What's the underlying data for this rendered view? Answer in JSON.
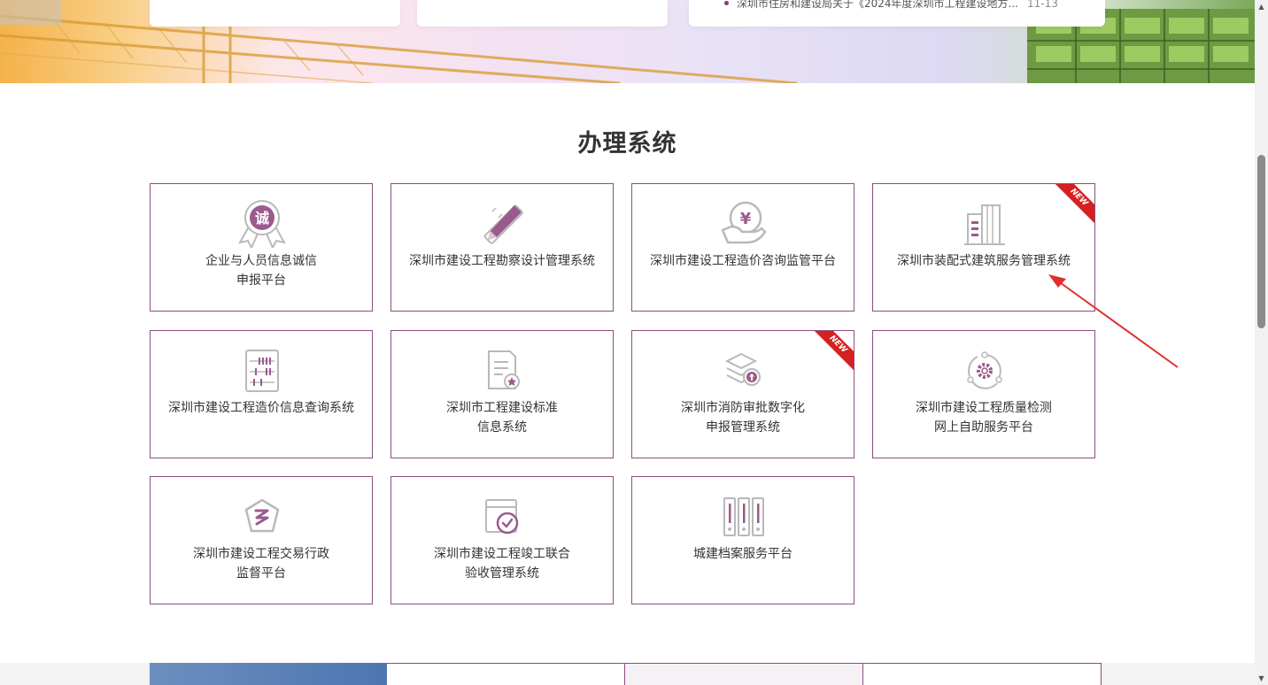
{
  "news": {
    "item_text": "深圳市住房和建设局关于《2024年度深圳市工程建设地方...",
    "item_date": "11-13"
  },
  "section": {
    "title": "办理系统"
  },
  "systems": [
    {
      "line1": "企业与人员信息诚信",
      "line2": "申报平台",
      "icon": "integrity-medal-icon",
      "icon_text": "诚",
      "is_new": false
    },
    {
      "line1": "深圳市建设工程勘察设计管理系统",
      "line2": "",
      "icon": "pencil-ruler-icon",
      "is_new": false
    },
    {
      "line1": "深圳市建设工程造价咨询监管平台",
      "line2": "",
      "icon": "yuan-hand-icon",
      "icon_text": "¥",
      "is_new": false
    },
    {
      "line1": "深圳市装配式建筑服务管理系统",
      "line2": "",
      "icon": "buildings-icon",
      "is_new": true
    },
    {
      "line1": "深圳市建设工程造价信息查询系统",
      "line2": "",
      "icon": "abacus-icon",
      "is_new": false
    },
    {
      "line1": "深圳市工程建设标准",
      "line2": "信息系统",
      "icon": "document-star-icon",
      "is_new": false
    },
    {
      "line1": "深圳市消防审批数字化",
      "line2": "申报管理系统",
      "icon": "layers-upload-icon",
      "is_new": true
    },
    {
      "line1": "深圳市建设工程质量检测",
      "line2": "网上自助服务平台",
      "icon": "gear-cycle-icon",
      "is_new": false
    },
    {
      "line1": "深圳市建设工程交易行政",
      "line2": "监督平台",
      "icon": "pentagon-shield-icon",
      "is_new": false
    },
    {
      "line1": "深圳市建设工程竣工联合",
      "line2": "验收管理系统",
      "icon": "calendar-check-icon",
      "is_new": false
    },
    {
      "line1": "城建档案服务平台",
      "line2": "",
      "icon": "archive-binders-icon",
      "is_new": false
    }
  ],
  "badge": {
    "new_label": "NEW"
  },
  "scrollbar": {
    "up": "▲",
    "down": "▼"
  },
  "colors": {
    "accent": "#8b4e80",
    "ribbon": "#d62020",
    "arrow": "#e0302a",
    "icon_gray": "#b9b9b9"
  }
}
